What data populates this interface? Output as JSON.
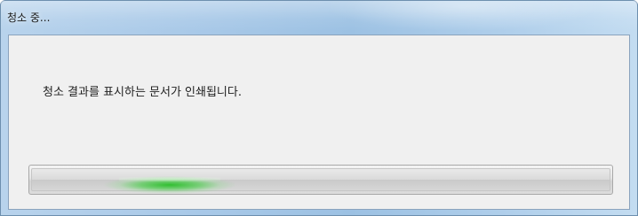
{
  "window": {
    "title": "청소 중..."
  },
  "dialog": {
    "message": "청소 결과를 표시하는 문서가 인쇄됩니다."
  },
  "progress": {
    "mode": "indeterminate",
    "accent_color": "#2fbf2f"
  },
  "colors": {
    "titlebar": "#a9c9e8",
    "client_background": "#f0f0f0"
  }
}
